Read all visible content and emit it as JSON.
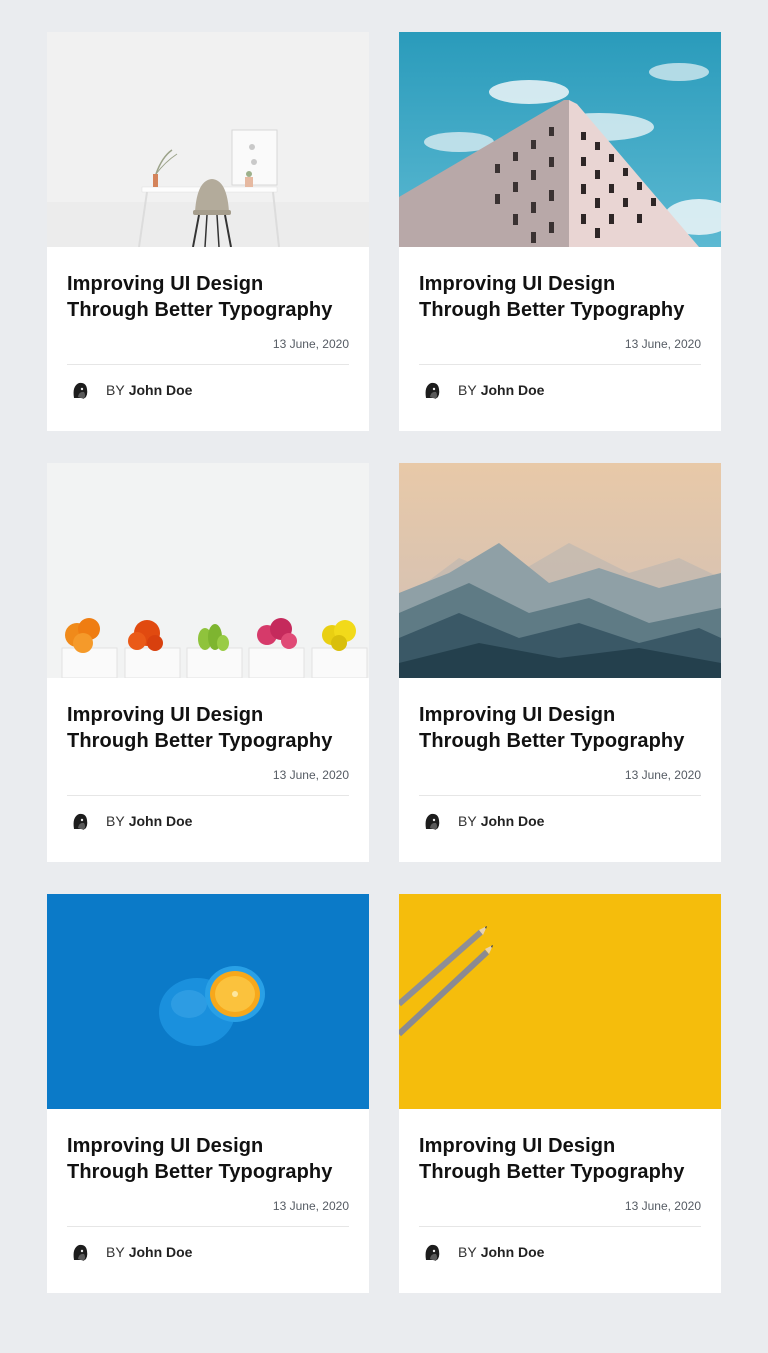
{
  "cards": [
    {
      "image_icon": "desk-chair-image",
      "title": "Improving UI Design Through Better Typography",
      "date": "13 June, 2020",
      "by_label": "BY",
      "author": "John Doe"
    },
    {
      "image_icon": "building-sky-image",
      "title": "Improving UI Design Through Better Typography",
      "date": "13 June, 2020",
      "by_label": "BY",
      "author": "John Doe"
    },
    {
      "image_icon": "cactus-pots-image",
      "title": "Improving UI Design Through Better Typography",
      "date": "13 June, 2020",
      "by_label": "BY",
      "author": "John Doe"
    },
    {
      "image_icon": "mountains-image",
      "title": "Improving UI Design Through Better Typography",
      "date": "13 June, 2020",
      "by_label": "BY",
      "author": "John Doe"
    },
    {
      "image_icon": "blue-orange-image",
      "title": "Improving UI Design Through Better Typography",
      "date": "13 June, 2020",
      "by_label": "BY",
      "author": "John Doe"
    },
    {
      "image_icon": "pencils-yellow-image",
      "title": "Improving UI Design Through Better Typography",
      "date": "13 June, 2020",
      "by_label": "BY",
      "author": "John Doe"
    }
  ],
  "colors": {
    "page_background": "#eaecef",
    "card_background": "#ffffff",
    "title_text": "#111111",
    "date_text": "#555b63"
  }
}
